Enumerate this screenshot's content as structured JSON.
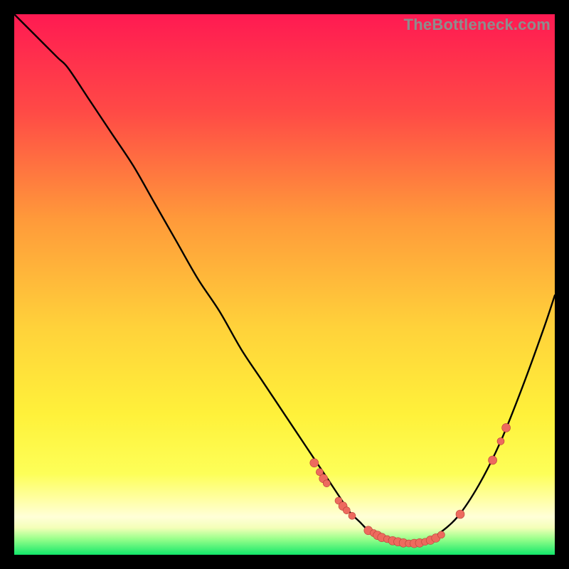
{
  "watermark": "TheBottleneck.com",
  "colors": {
    "gradient_top": "#ff1a52",
    "gradient_upper_mid": "#ff7a3a",
    "gradient_mid": "#ffd23a",
    "gradient_lower_mid": "#fff13a",
    "gradient_low": "#fbff6e",
    "gradient_band_pale": "#ffffbf",
    "gradient_bottom": "#12e86a",
    "curve": "#000000",
    "dot_fill": "#ed6a5e",
    "dot_stroke": "#b83f37"
  },
  "chart_data": {
    "type": "line",
    "title": "",
    "xlabel": "",
    "ylabel": "",
    "xlim": [
      0,
      100
    ],
    "ylim": [
      0,
      100
    ],
    "series": [
      {
        "name": "bottleneck-curve",
        "x": [
          0,
          4,
          8,
          10,
          14,
          18,
          22,
          26,
          30,
          34,
          38,
          42,
          46,
          50,
          54,
          58,
          60,
          62,
          64,
          66,
          68,
          70,
          72,
          74,
          76,
          78,
          82,
          86,
          90,
          94,
          98,
          100
        ],
        "y": [
          100,
          96,
          92,
          90,
          84,
          78,
          72,
          65,
          58,
          51,
          45,
          38,
          32,
          26,
          20,
          14,
          11,
          8,
          6,
          4,
          3,
          2.5,
          2,
          2,
          2.5,
          3.5,
          7,
          13,
          21,
          31,
          42,
          48
        ]
      }
    ],
    "markers": [
      {
        "x": 55.5,
        "y": 17,
        "r": 6
      },
      {
        "x": 56.5,
        "y": 15.3,
        "r": 5
      },
      {
        "x": 57.2,
        "y": 14.1,
        "r": 6
      },
      {
        "x": 57.8,
        "y": 13.2,
        "r": 5
      },
      {
        "x": 60.0,
        "y": 10.0,
        "r": 5
      },
      {
        "x": 60.8,
        "y": 9.0,
        "r": 6
      },
      {
        "x": 61.5,
        "y": 8.2,
        "r": 5
      },
      {
        "x": 62.5,
        "y": 7.2,
        "r": 5
      },
      {
        "x": 65.5,
        "y": 4.5,
        "r": 6
      },
      {
        "x": 66.5,
        "y": 4.0,
        "r": 5
      },
      {
        "x": 67.2,
        "y": 3.6,
        "r": 6
      },
      {
        "x": 68.0,
        "y": 3.2,
        "r": 6
      },
      {
        "x": 69.0,
        "y": 2.9,
        "r": 5
      },
      {
        "x": 70.0,
        "y": 2.6,
        "r": 6
      },
      {
        "x": 71.0,
        "y": 2.4,
        "r": 6
      },
      {
        "x": 72.0,
        "y": 2.2,
        "r": 6
      },
      {
        "x": 73.0,
        "y": 2.1,
        "r": 5
      },
      {
        "x": 74.0,
        "y": 2.1,
        "r": 6
      },
      {
        "x": 75.0,
        "y": 2.2,
        "r": 6
      },
      {
        "x": 76.0,
        "y": 2.4,
        "r": 5
      },
      {
        "x": 77.0,
        "y": 2.7,
        "r": 6
      },
      {
        "x": 78.0,
        "y": 3.1,
        "r": 6
      },
      {
        "x": 79.0,
        "y": 3.7,
        "r": 5
      },
      {
        "x": 82.5,
        "y": 7.5,
        "r": 6
      },
      {
        "x": 88.5,
        "y": 17.5,
        "r": 6
      },
      {
        "x": 90.0,
        "y": 21.0,
        "r": 5
      },
      {
        "x": 91.0,
        "y": 23.5,
        "r": 6
      }
    ]
  }
}
